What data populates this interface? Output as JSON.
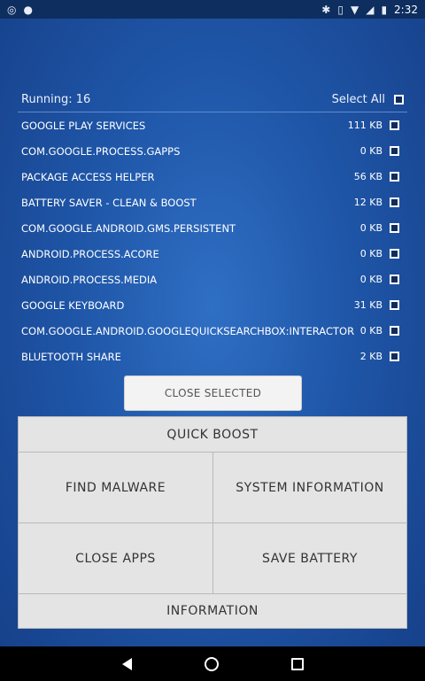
{
  "statusbar": {
    "time": "2:32"
  },
  "header": {
    "running_label": "Running: 16",
    "select_all_label": "Select All"
  },
  "apps": [
    {
      "name": "GOOGLE PLAY SERVICES",
      "size": "111 KB"
    },
    {
      "name": "COM.GOOGLE.PROCESS.GAPPS",
      "size": "0 KB"
    },
    {
      "name": "PACKAGE ACCESS HELPER",
      "size": "56 KB"
    },
    {
      "name": "BATTERY SAVER - CLEAN & BOOST",
      "size": "12 KB"
    },
    {
      "name": "COM.GOOGLE.ANDROID.GMS.PERSISTENT",
      "size": "0 KB"
    },
    {
      "name": "ANDROID.PROCESS.ACORE",
      "size": "0 KB"
    },
    {
      "name": "ANDROID.PROCESS.MEDIA",
      "size": "0 KB"
    },
    {
      "name": "GOOGLE KEYBOARD",
      "size": "31 KB"
    },
    {
      "name": "COM.GOOGLE.ANDROID.GOOGLEQUICKSEARCHBOX:INTERACTOR",
      "size": "0 KB"
    },
    {
      "name": "BLUETOOTH SHARE",
      "size": "2 KB"
    }
  ],
  "close_selected_label": "CLOSE SELECTED",
  "menu": {
    "quick_boost": "QUICK BOOST",
    "find_malware": "FIND MALWARE",
    "system_information": "SYSTEM INFORMATION",
    "close_apps": "CLOSE APPS",
    "save_battery": "SAVE BATTERY",
    "information": "INFORMATION"
  }
}
